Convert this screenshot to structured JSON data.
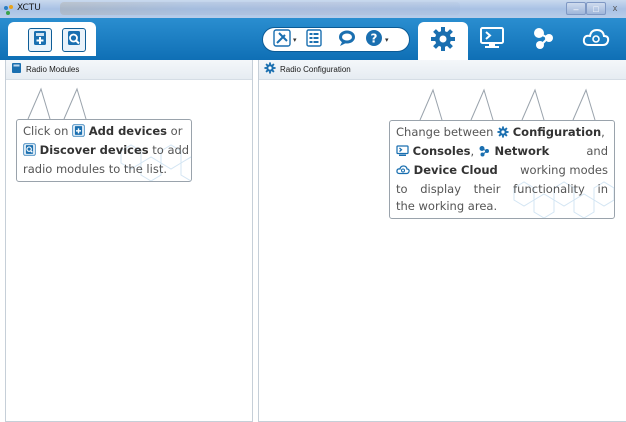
{
  "window": {
    "title": "XCTU",
    "controls": {
      "minimize": "–",
      "maximize": "□",
      "close": "x"
    }
  },
  "toolbar": {
    "left_buttons": [
      {
        "name": "add-devices",
        "icon": "add-device-icon"
      },
      {
        "name": "discover-devices",
        "icon": "discover-devices-icon"
      }
    ],
    "tools": [
      {
        "icon": "tools-icon",
        "caret": "▾"
      },
      {
        "icon": "frames-icon",
        "caret": ""
      },
      {
        "icon": "feedback-icon",
        "caret": ""
      },
      {
        "icon": "help-icon",
        "caret": "▾"
      }
    ],
    "modes": [
      {
        "name": "configuration",
        "icon": "gear-icon",
        "active": true
      },
      {
        "name": "consoles",
        "icon": "console-icon",
        "active": false
      },
      {
        "name": "network",
        "icon": "network-icon",
        "active": false
      },
      {
        "name": "device-cloud",
        "icon": "cloud-icon",
        "active": false
      }
    ],
    "colors": {
      "bar": "#1478bf",
      "icon": "#1a6fb0"
    }
  },
  "left_panel": {
    "title": "Radio Modules",
    "hint": {
      "line1_a": "Click on ",
      "line1_b": "Add devices",
      "line1_c": " or",
      "line2_a": "Discover devices",
      "line2_b": " to add",
      "line3": "radio modules to the list."
    }
  },
  "right_panel": {
    "title": "Radio Configuration",
    "hint": {
      "l1_a": "Change between ",
      "l1_b": "Configuration",
      "l1_c": ",",
      "l2_a": "Consoles",
      "l2_b": ", ",
      "l2_c": "Network",
      "l2_d": "and",
      "l3_a": "Device Cloud",
      "l3_b": "working modes",
      "l4": "to display their functionality in",
      "l5": "the working area."
    }
  }
}
